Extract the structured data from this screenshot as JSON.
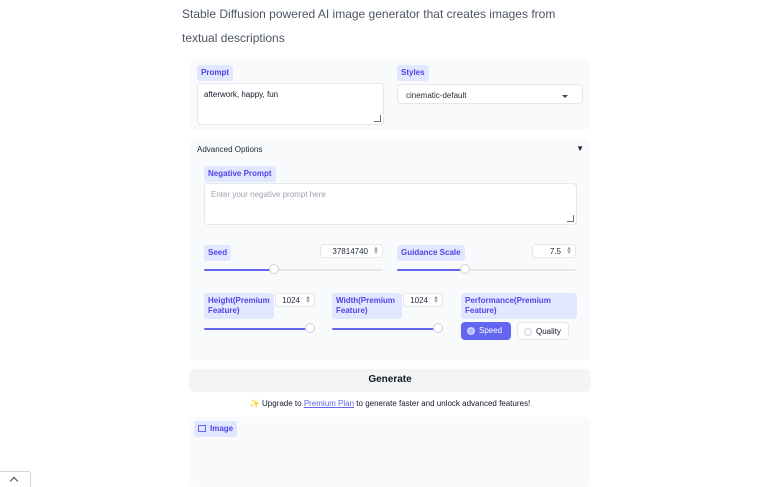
{
  "description": "Stable Diffusion powered AI image generator that creates images from textual descriptions",
  "prompt": {
    "label": "Prompt",
    "value": "afterwork, happy, fun"
  },
  "styles": {
    "label": "Styles",
    "value": "cinematic-default"
  },
  "advanced": {
    "title": "Advanced Options",
    "toggle_glyph": "▼",
    "negative": {
      "label": "Negative Prompt",
      "placeholder": "Enter your negative prompt here"
    },
    "seed": {
      "label": "Seed",
      "value": "37814740",
      "slider_fraction": 0.39
    },
    "guidance": {
      "label": "Guidance Scale",
      "value": "7.5",
      "slider_fraction": 0.38
    },
    "height": {
      "label": "Height(Premium Feature)",
      "value": "1024",
      "slider_fraction": 0.96
    },
    "width": {
      "label": "Width(Premium Feature)",
      "value": "1024",
      "slider_fraction": 0.96
    },
    "performance": {
      "label": "Performance(Premium Feature)",
      "options": [
        "Speed",
        "Quality"
      ],
      "selected": "Speed"
    }
  },
  "generate_label": "Generate",
  "upgrade": {
    "sparkle": "✨",
    "prefix": "Upgrade to",
    "link": "Premium Plan",
    "suffix": "to generate faster and unlock advanced features!"
  },
  "output": {
    "label": "Image",
    "icon": "image-icon"
  },
  "colors": {
    "accent": "#6366f1",
    "pill_bg": "#e0e7ff"
  }
}
